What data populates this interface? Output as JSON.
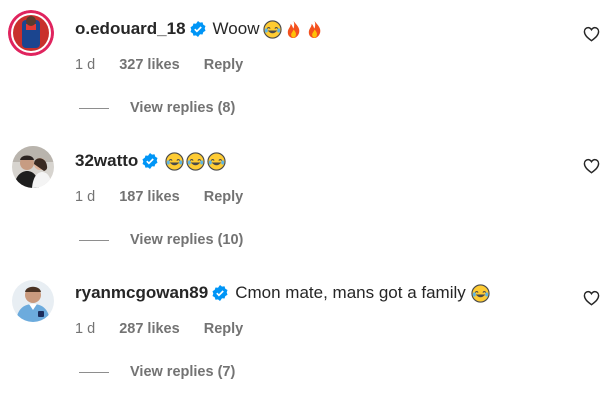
{
  "comments": [
    {
      "username": "o.edouard_18",
      "text": "Woow",
      "emojis": [
        "laughing-tears-emoji",
        "fire-emoji",
        "fire-emoji"
      ],
      "time": "1 d",
      "likes": "327 likes",
      "reply_label": "Reply",
      "view_replies": "View replies (8)"
    },
    {
      "username": "32watto",
      "text": "",
      "emojis": [
        "laughing-tears-emoji",
        "laughing-tears-emoji",
        "laughing-tears-emoji"
      ],
      "time": "1 d",
      "likes": "187 likes",
      "reply_label": "Reply",
      "view_replies": "View replies (10)"
    },
    {
      "username": "ryanmcgowan89",
      "text": "Cmon mate, mans got a family",
      "emojis": [
        "laughing-tears-emoji"
      ],
      "time": "1 d",
      "likes": "287 likes",
      "reply_label": "Reply",
      "view_replies": "View replies (7)"
    }
  ],
  "colors": {
    "verified": "#0095f6",
    "meta_text": "#737373",
    "primary_text": "#262626"
  }
}
